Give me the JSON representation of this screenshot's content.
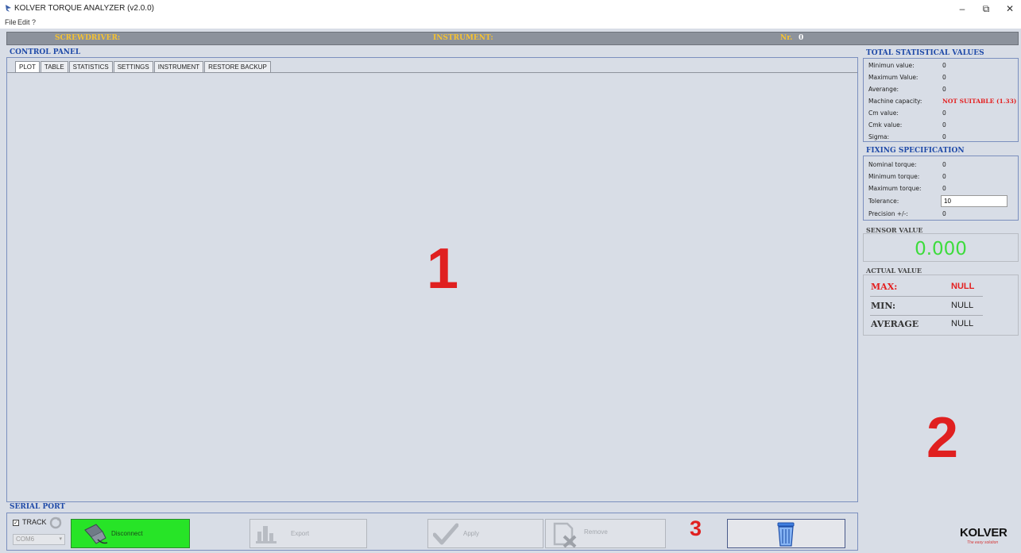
{
  "window": {
    "title": "KOLVER TORQUE ANALYZER (v2.0.0)",
    "min_glyph": "–",
    "max_glyph": "⧉",
    "close_glyph": "✕"
  },
  "menu": [
    "File",
    "Edit",
    "?"
  ],
  "infobar": {
    "screwdriver_label": "SCREWDRIVER:",
    "instrument_label": "INSTRUMENT:",
    "nr_label": "Nr.",
    "nr_value": "0"
  },
  "control_panel": {
    "label": "CONTROL PANEL",
    "tabs": [
      "PLOT",
      "TABLE",
      "STATISTICS",
      "SETTINGS",
      "INSTRUMENT",
      "RESTORE BACKUP"
    ],
    "active_tab": "PLOT"
  },
  "annotations": {
    "one": "1",
    "two": "2",
    "three": "3"
  },
  "total_stats": {
    "label": "TOTAL STATISTICAL VALUES",
    "rows": [
      {
        "label": "Minimun value:",
        "value": "0"
      },
      {
        "label": "Maximum Value:",
        "value": "0"
      },
      {
        "label": "Averange:",
        "value": "0"
      },
      {
        "label": "Machine capacity:",
        "value": "NOT SUITABLE (1.33)"
      },
      {
        "label": "Cm value:",
        "value": "0"
      },
      {
        "label": "Cmk value:",
        "value": "0"
      },
      {
        "label": "Sigma:",
        "value": "0"
      }
    ]
  },
  "fixing_spec": {
    "label": "FIXING SPECIFICATION",
    "rows": [
      {
        "label": "Nominal torque:",
        "value": "0"
      },
      {
        "label": "Minimum torque:",
        "value": "0"
      },
      {
        "label": "Maximum torque:",
        "value": "0"
      },
      {
        "label": "Tolerance:",
        "value": "10"
      },
      {
        "label": "Precision +/-:",
        "value": "0"
      }
    ]
  },
  "sensor": {
    "label": "SENSOR VALUE",
    "value": "0.000"
  },
  "actual": {
    "label": "ACTUAL VALUE",
    "rows": [
      {
        "label": "MAX:",
        "value": "NULL"
      },
      {
        "label": "MIN:",
        "value": "NULL"
      },
      {
        "label": "AVERAGE",
        "value": "NULL"
      }
    ]
  },
  "serial_port": {
    "label": "SERIAL PORT",
    "track_label": "TRACK",
    "track_checked": true,
    "com_port": "COM6",
    "buttons": {
      "disconnect": "Disconnect",
      "export": "Export",
      "apply": "Apply",
      "remove": "Remove"
    }
  },
  "logo": {
    "brand": "KOLVER",
    "tagline": "The easy solution"
  },
  "colors": {
    "accent_blue": "#1f4aa8",
    "alert_red": "#e41f1f",
    "sensor_green": "#3ddc3d",
    "disconnect_green": "#27e427",
    "infobar_gold": "#f6c230"
  }
}
